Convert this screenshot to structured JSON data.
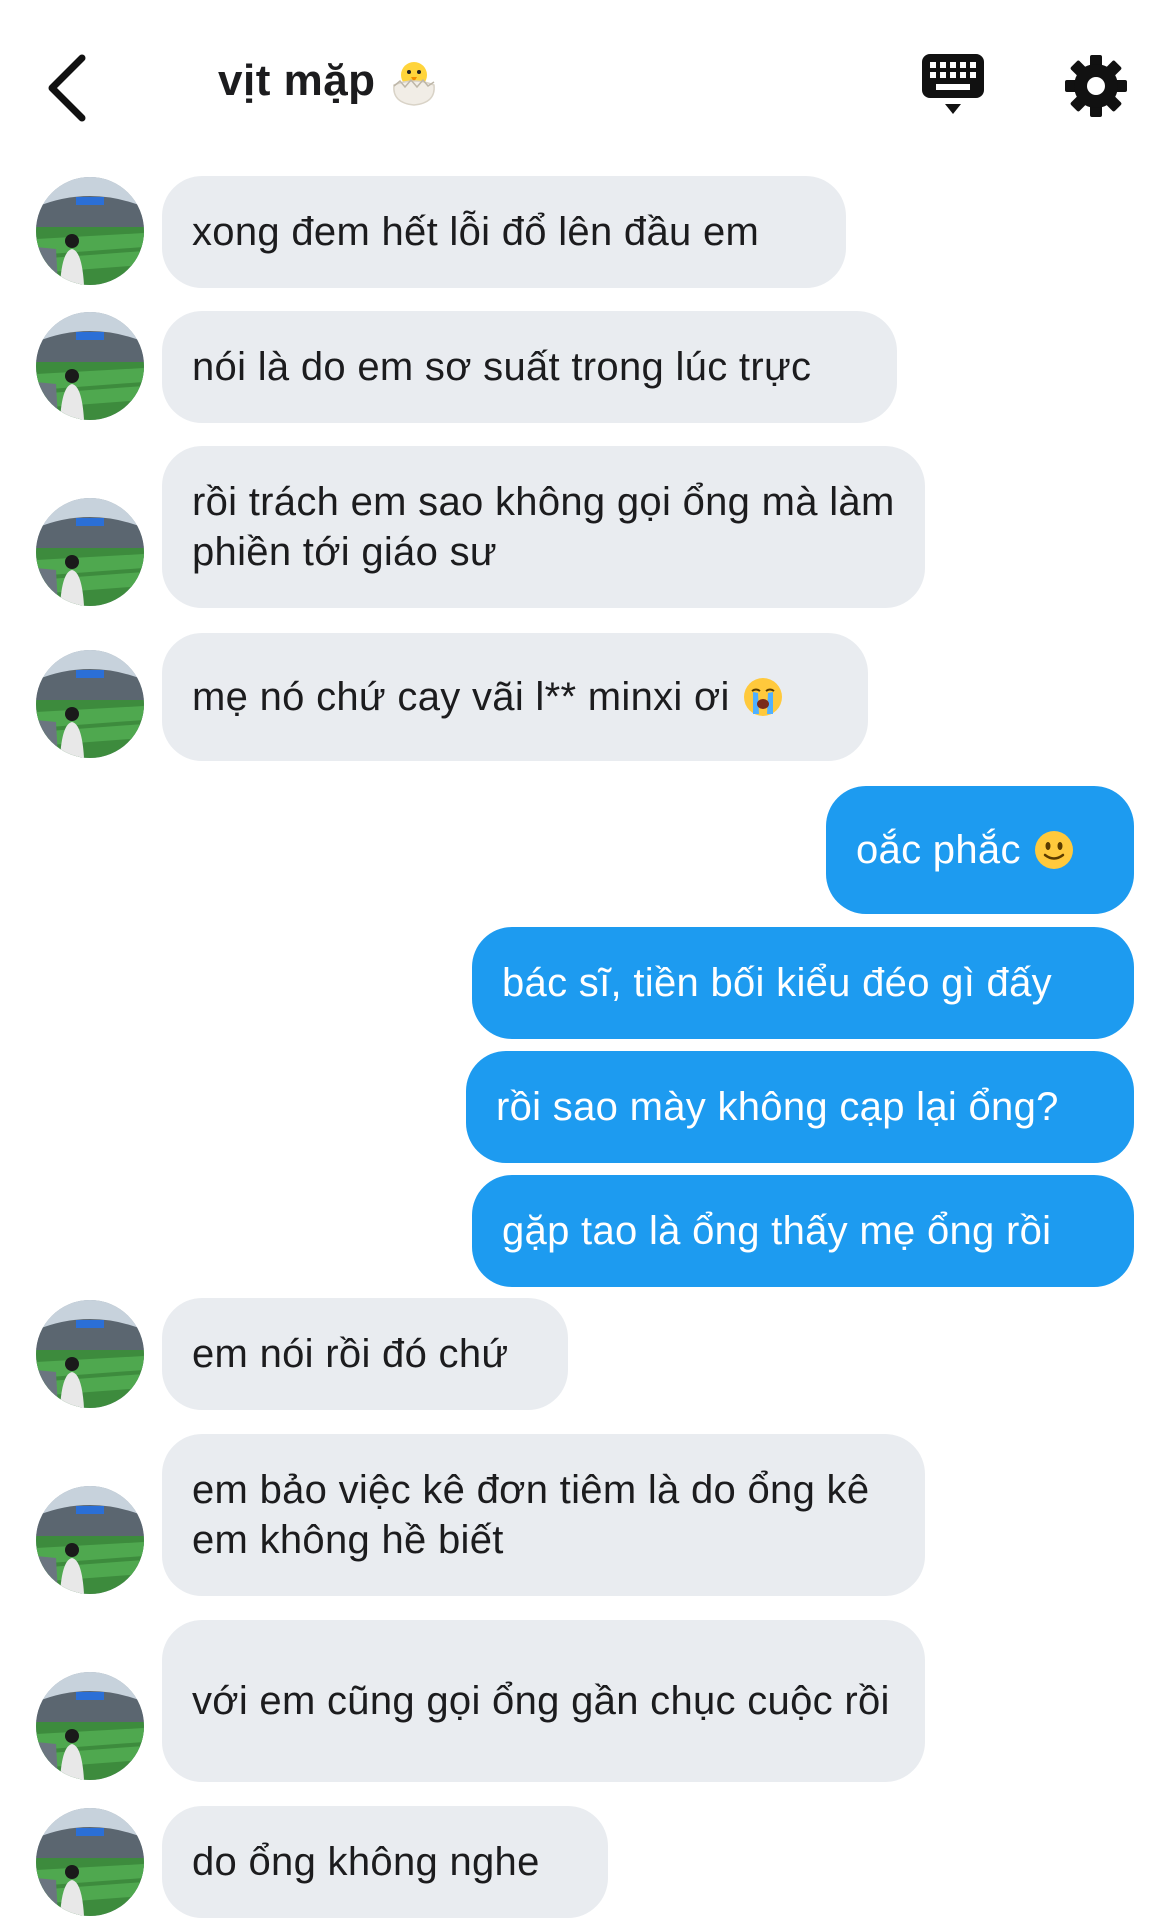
{
  "header": {
    "title": "vịt mặp",
    "back_icon": "chevron-left-icon",
    "title_emoji": "hatching-chick-icon",
    "keyboard_icon": "keyboard-icon",
    "settings_icon": "gear-icon"
  },
  "colors": {
    "incoming_bubble": "#e9ecf0",
    "outgoing_bubble": "#1d9bf0",
    "text": "#1c1c1e"
  },
  "messages": [
    {
      "direction": "in",
      "text": "xong đem hết lỗi đổ lên đầu em"
    },
    {
      "direction": "in",
      "text": "nói là do em sơ suất trong lúc trực"
    },
    {
      "direction": "in",
      "text": "rồi trách em sao không gọi ổng mà làm phiền tới giáo sư"
    },
    {
      "direction": "in",
      "text": "mẹ nó chứ cay vãi l** minxi ơi",
      "emoji": "loudly-crying-face-icon"
    },
    {
      "direction": "out",
      "text": "oắc phắc",
      "emoji": "slightly-smiling-face-icon"
    },
    {
      "direction": "out",
      "text": "bác sĩ, tiền bối kiểu đéo gì đấy"
    },
    {
      "direction": "out",
      "text": "rồi sao mày không cạp lại ổng?"
    },
    {
      "direction": "out",
      "text": "gặp tao là ổng thấy mẹ ổng rồi"
    },
    {
      "direction": "in",
      "text": "em nói rồi đó chứ"
    },
    {
      "direction": "in",
      "text": "em bảo việc kê đơn tiêm là do ổng kê em không hề biết"
    },
    {
      "direction": "in",
      "text": "với em cũng gọi ổng gần chục cuộc rồi"
    },
    {
      "direction": "in",
      "text": "do ổng không nghe"
    }
  ]
}
